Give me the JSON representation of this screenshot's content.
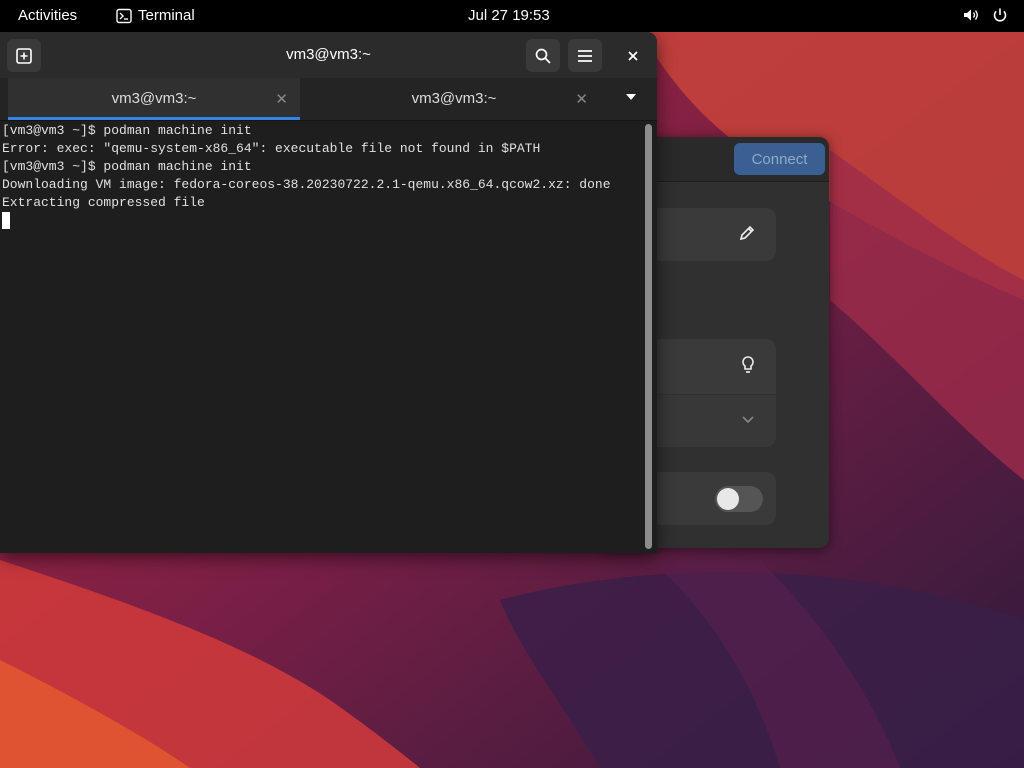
{
  "topbar": {
    "activities": "Activities",
    "app_name": "Terminal",
    "clock": "Jul 27  19:53",
    "icons": [
      "volume-icon",
      "power-icon"
    ]
  },
  "terminal": {
    "title": "vm3@vm3:~",
    "tabs": [
      {
        "label": "vm3@vm3:~",
        "active": true
      },
      {
        "label": "vm3@vm3:~",
        "active": false
      }
    ],
    "lines": [
      "[vm3@vm3 ~]$ podman machine init",
      "Error: exec: \"qemu-system-x86_64\": executable file not found in $PATH",
      "[vm3@vm3 ~]$ podman machine init",
      "Downloading VM image: fedora-coreos-38.20230722.2.1-qemu.x86_64.qcow2.xz: done",
      "Extracting compressed file"
    ]
  },
  "background_window": {
    "connect_label": "Connect",
    "icons": [
      "pencil-icon",
      "lightbulb-icon",
      "chevron-down-icon"
    ],
    "switch_on": false
  },
  "colors": {
    "accent": "#3584e4",
    "connect_button": "#3a5f93",
    "terminal_bg": "#1e1e1e"
  }
}
